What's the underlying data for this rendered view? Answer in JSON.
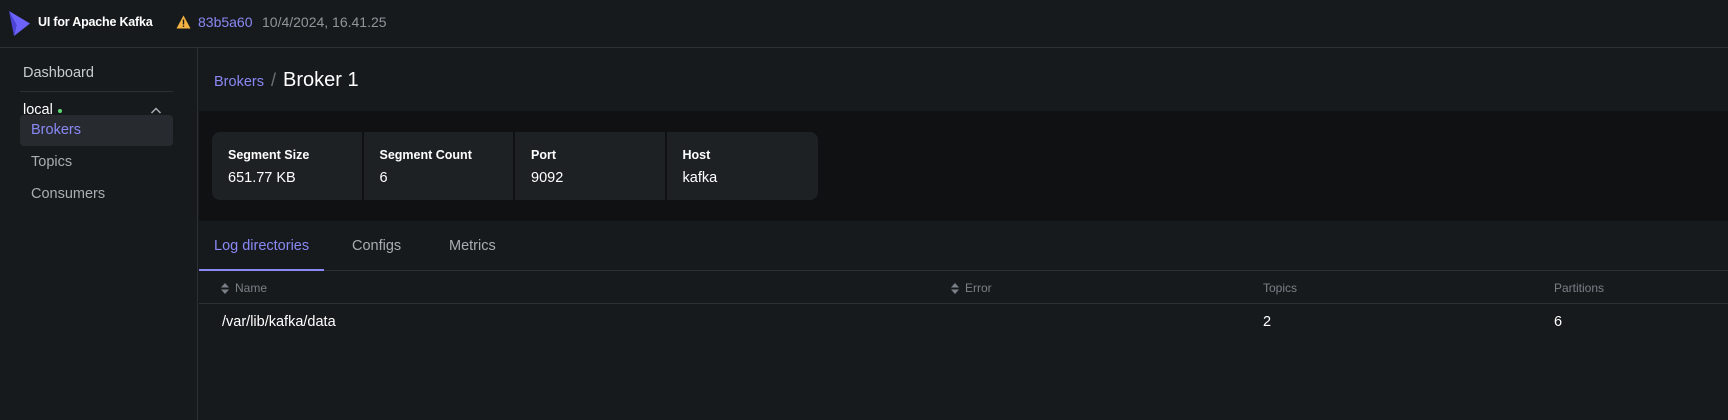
{
  "navbar": {
    "app_title": "UI for Apache Kafka",
    "commit": "83b5a60",
    "build_date": "10/4/2024, 16.41.25",
    "warning_color": "#f5b342",
    "accent_color": "#8a88f6"
  },
  "sidebar": {
    "dashboard_label": "Dashboard",
    "cluster_name": "local",
    "cluster_status_color": "#5ed672",
    "items": [
      {
        "label": "Brokers",
        "active": true
      },
      {
        "label": "Topics",
        "active": false
      },
      {
        "label": "Consumers",
        "active": false
      }
    ]
  },
  "breadcrumb": {
    "parent": "Brokers",
    "separator": "/",
    "current": "Broker 1"
  },
  "metrics": [
    {
      "label": "Segment Size",
      "value": "651.77 KB"
    },
    {
      "label": "Segment Count",
      "value": "6"
    },
    {
      "label": "Port",
      "value": "9092"
    },
    {
      "label": "Host",
      "value": "kafka"
    }
  ],
  "tabs": [
    {
      "label": "Log directories",
      "active": true
    },
    {
      "label": "Configs",
      "active": false
    },
    {
      "label": "Metrics",
      "active": false
    }
  ],
  "table": {
    "columns": [
      "Name",
      "Error",
      "Topics",
      "Partitions"
    ],
    "rows": [
      {
        "name": "/var/lib/kafka/data",
        "error": "",
        "topics": "2",
        "partitions": "6"
      }
    ]
  }
}
